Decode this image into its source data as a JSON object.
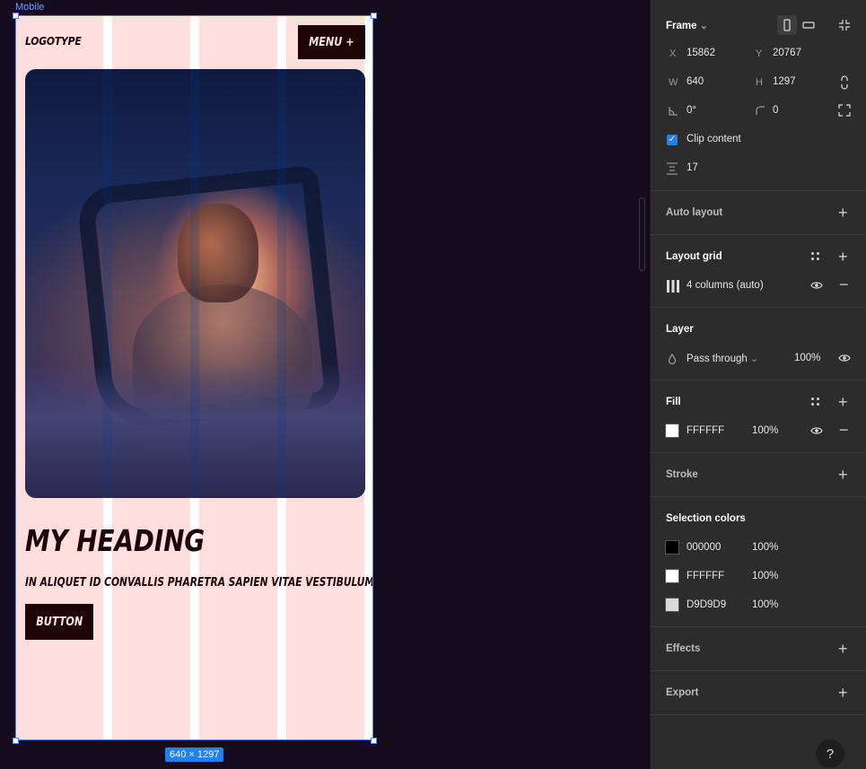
{
  "canvas": {
    "frame_label": "Mobile",
    "dimensions": "640 × 1297"
  },
  "mock": {
    "logo": "LOGOTYPE",
    "menu_button": "MENU +",
    "heading": "MY HEADING",
    "subtitle": "IN ALIQUET ID CONVALLIS PHARETRA SAPIEN VITAE VESTIBULUM.",
    "button": "BUTTON"
  },
  "frame": {
    "title": "Frame",
    "x_label": "X",
    "x": "15862",
    "y_label": "Y",
    "y": "20767",
    "w_label": "W",
    "w": "640",
    "h_label": "H",
    "h": "1297",
    "rotation": "0°",
    "radius": "0",
    "clip_label": "Clip content",
    "clip_checked": true,
    "spacing": "17"
  },
  "auto_layout": {
    "title": "Auto layout"
  },
  "layout_grid": {
    "title": "Layout grid",
    "grid": "4 columns (auto)"
  },
  "layer": {
    "title": "Layer",
    "blend": "Pass through",
    "opacity": "100%"
  },
  "fill": {
    "title": "Fill",
    "hex": "FFFFFF",
    "opacity": "100%",
    "color": "#FFFFFF"
  },
  "stroke": {
    "title": "Stroke"
  },
  "selection_colors": {
    "title": "Selection colors",
    "items": [
      {
        "hex": "000000",
        "opacity": "100%",
        "color": "#000000"
      },
      {
        "hex": "FFFFFF",
        "opacity": "100%",
        "color": "#FFFFFF"
      },
      {
        "hex": "D9D9D9",
        "opacity": "100%",
        "color": "#D9D9D9"
      }
    ]
  },
  "effects": {
    "title": "Effects"
  },
  "export": {
    "title": "Export"
  },
  "help": "?",
  "colors": {
    "canvas_bg": "#150C1F",
    "frame_bg": "#FFDEDE",
    "dark": "#1E0307",
    "accent": "#2680EB"
  }
}
